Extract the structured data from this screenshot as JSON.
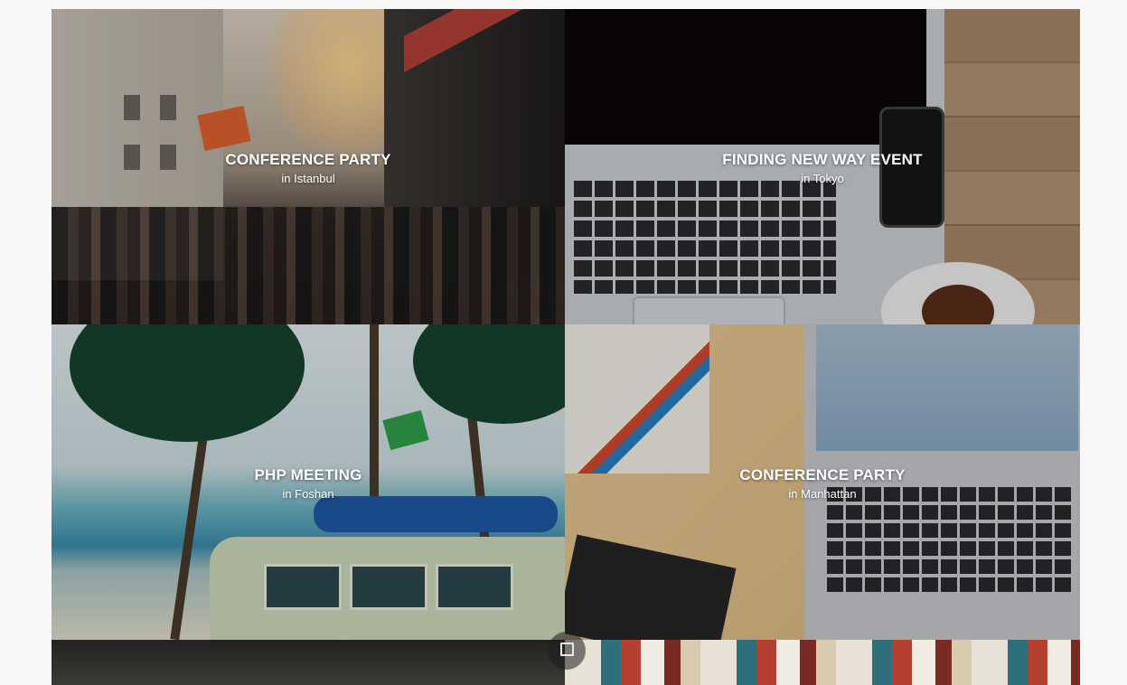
{
  "events": [
    {
      "title": "CONFERENCE PARTY",
      "location": "in Istanbul"
    },
    {
      "title": "FINDING NEW WAY EVENT",
      "location": "in Tokyo"
    },
    {
      "title": "PHP MEETING",
      "location": "in Foshan"
    },
    {
      "title": "CONFERENCE PARTY",
      "location": "in Manhattan"
    }
  ],
  "partial_tiles": [
    {
      "image": "dark-camera-photo"
    },
    {
      "image": "bookshelf-photo"
    }
  ],
  "floating_button": {
    "icon": "square-icon"
  }
}
